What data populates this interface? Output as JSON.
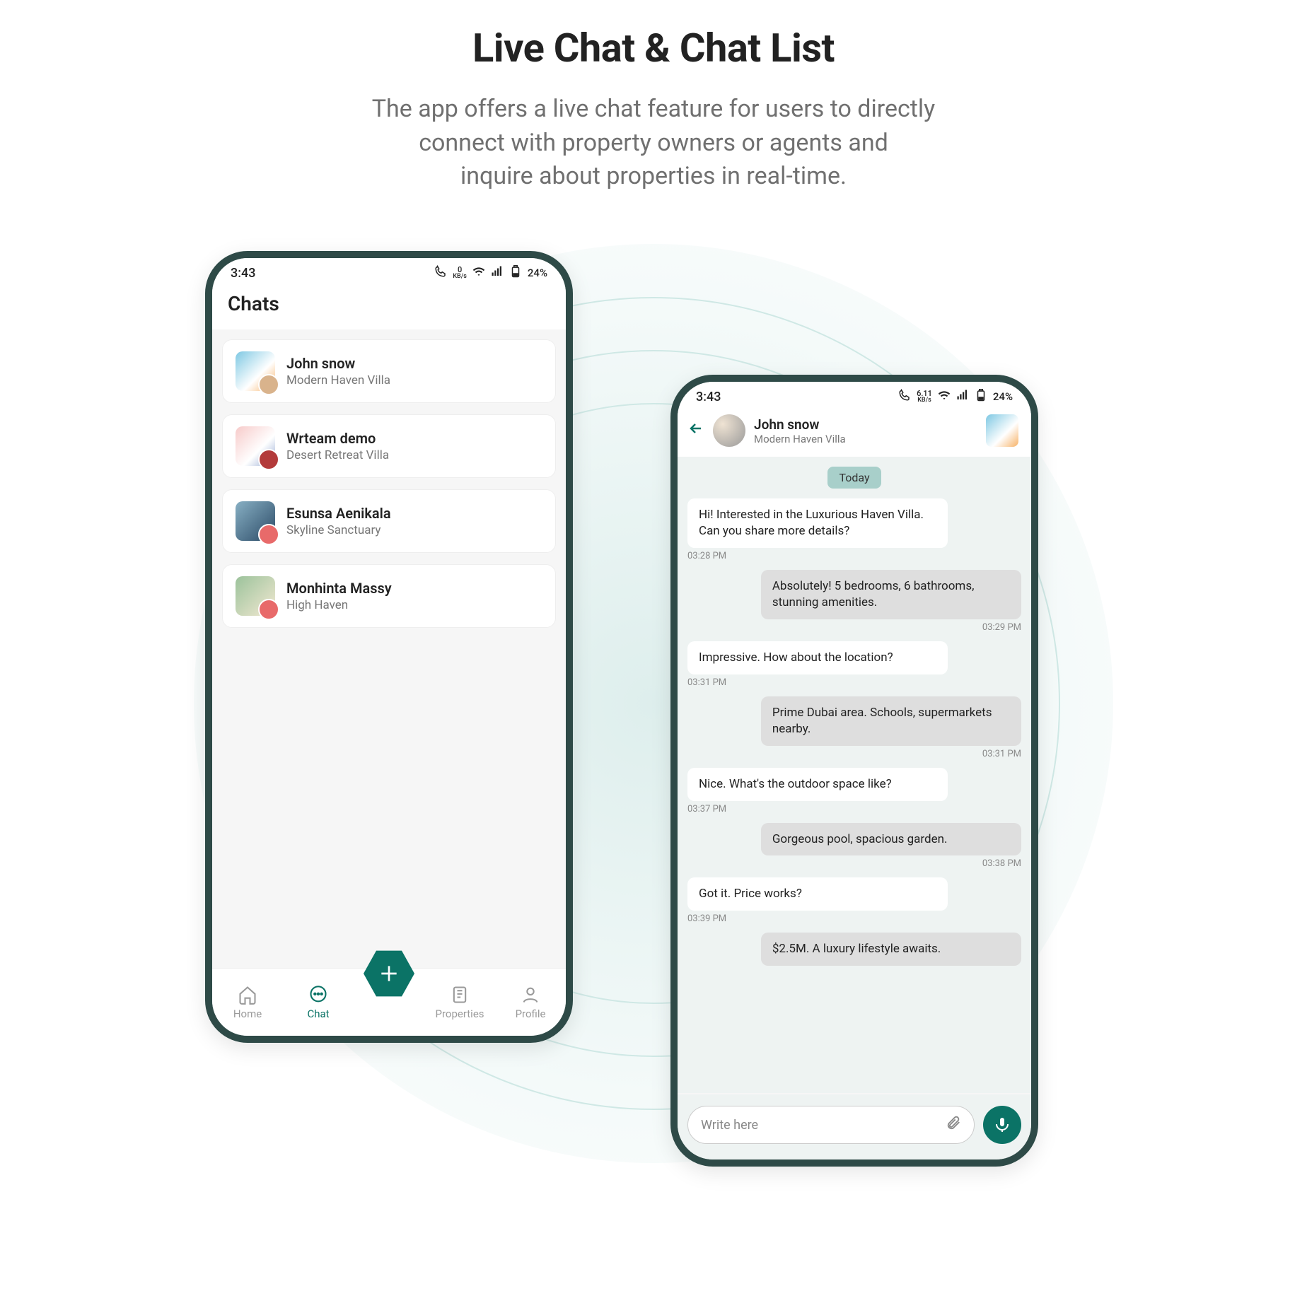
{
  "page": {
    "title": "Live Chat & Chat List",
    "subtitle_l1": "The app offers a live chat feature for users to directly",
    "subtitle_l2": "connect with property owners or agents and",
    "subtitle_l3": "inquire about properties in real-time."
  },
  "status_left": {
    "time": "3:43",
    "kb": "0",
    "kb_unit": "KB/s",
    "battery": "24%"
  },
  "status_right": {
    "time": "3:43",
    "kb": "6.11",
    "kb_unit": "KB/s",
    "battery": "24%"
  },
  "chat_list": {
    "header": "Chats",
    "items": [
      {
        "name": "John snow",
        "sub": "Modern Haven Villa"
      },
      {
        "name": "Wrteam demo",
        "sub": "Desert Retreat Villa"
      },
      {
        "name": "Esunsa Aenikala",
        "sub": "Skyline Sanctuary"
      },
      {
        "name": "Monhinta Massy",
        "sub": "High Haven"
      }
    ]
  },
  "nav": {
    "home": "Home",
    "chat": "Chat",
    "properties": "Properties",
    "profile": "Profile"
  },
  "conversation": {
    "name": "John snow",
    "sub": "Modern Haven Villa",
    "date_label": "Today",
    "messages": [
      {
        "dir": "in",
        "text": "Hi! Interested in the Luxurious Haven Villa. Can you share more details?",
        "time": "03:28 PM"
      },
      {
        "dir": "out",
        "text": "Absolutely! 5 bedrooms, 6 bathrooms, stunning amenities.",
        "time": "03:29 PM"
      },
      {
        "dir": "in",
        "text": "Impressive. How about the location?",
        "time": "03:31 PM"
      },
      {
        "dir": "out",
        "text": "Prime Dubai area. Schools, supermarkets nearby.",
        "time": "03:31 PM"
      },
      {
        "dir": "in",
        "text": "Nice. What's the outdoor space like?",
        "time": "03:37 PM"
      },
      {
        "dir": "out",
        "text": "Gorgeous pool, spacious garden.",
        "time": "03:38 PM"
      },
      {
        "dir": "in",
        "text": "Got it. Price works?",
        "time": "03:39 PM"
      },
      {
        "dir": "out",
        "text": "$2.5M. A luxury lifestyle awaits.",
        "time": ""
      }
    ],
    "input_placeholder": "Write here"
  }
}
